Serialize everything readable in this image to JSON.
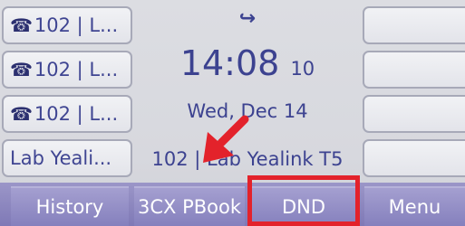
{
  "line_keys": [
    {
      "icon": "phone-icon",
      "label": "102 | L..."
    },
    {
      "icon": "phone-icon",
      "label": "102 | L..."
    },
    {
      "icon": "phone-icon",
      "label": "102 | L..."
    },
    {
      "icon": "",
      "label": "Lab Yeali..."
    }
  ],
  "status": {
    "forward_icon": "↪"
  },
  "clock": {
    "time": "14:08",
    "seconds": "10",
    "date": "Wed, Dec 14"
  },
  "account": {
    "label": "102 | Lab Yealink T5"
  },
  "softkeys": [
    {
      "label": "History"
    },
    {
      "label": "3CX PBook"
    },
    {
      "label": "DND"
    },
    {
      "label": "Menu"
    }
  ],
  "annotation": {
    "highlight_color": "#e3222b",
    "arrow_color": "#e3222b"
  }
}
